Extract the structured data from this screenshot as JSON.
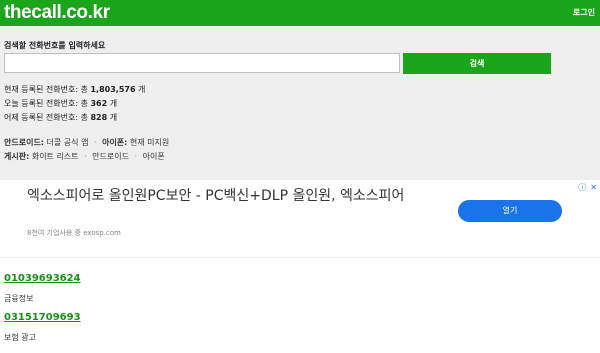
{
  "header": {
    "logo": "thecall.co.kr",
    "login": "로그인"
  },
  "search": {
    "label": "검색할 전화번호를 입력하세요",
    "placeholder": "",
    "button": "검색"
  },
  "stats": [
    {
      "prefix": "현재 등록된 전화번호: 총 ",
      "value": "1,803,576",
      "suffix": " 개"
    },
    {
      "prefix": "오늘 등록된 전화번호: 총 ",
      "value": "362",
      "suffix": " 개"
    },
    {
      "prefix": "어제 등록된 전화번호: 총 ",
      "value": "828",
      "suffix": " 개"
    }
  ],
  "links": {
    "android_label": "안드로이드:",
    "android_app": "더콜 공식 앱",
    "iphone_label": "아이폰:",
    "iphone_text": "현재 미지원",
    "board_label": "게시판:",
    "board_items": [
      "화이트 리스트",
      "안드로이드",
      "아이폰"
    ]
  },
  "ad": {
    "title": "엑소스피어로 올인원PC보안 - PC백신+DLP 올인원, 엑소스피어",
    "subtitle": "8천여 기업사용 중 exosp.com",
    "button": "열기"
  },
  "results": [
    {
      "number": "01039693624",
      "desc": "금융정보"
    },
    {
      "number": "03151709693",
      "desc": "보험 광고"
    }
  ]
}
